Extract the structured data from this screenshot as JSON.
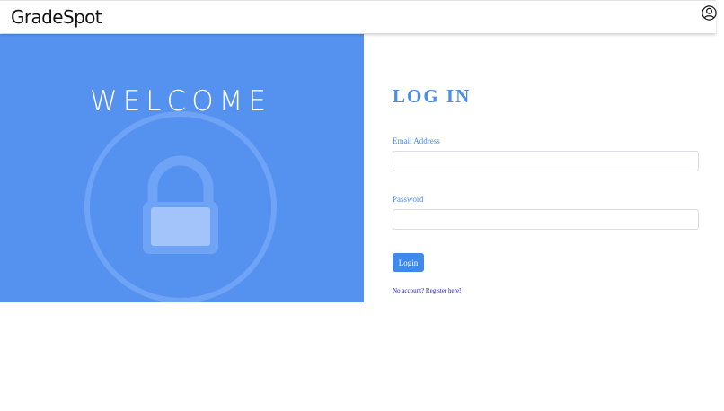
{
  "navbar": {
    "brand": "GradeSpot",
    "account_icon": "user-circle-icon"
  },
  "hero": {
    "title": "WELCOME",
    "background_color": "#5591ef",
    "watermark_icon": "lock-icon"
  },
  "login_form": {
    "title": "LOG IN",
    "email_label": "Email Address",
    "email_value": "",
    "password_label": "Password",
    "password_value": "",
    "submit_label": "Login",
    "register_link": "No account? Register here!"
  },
  "colors": {
    "accent": "#4b8de9",
    "button": "#3f88ec",
    "link": "#1a12c9"
  }
}
